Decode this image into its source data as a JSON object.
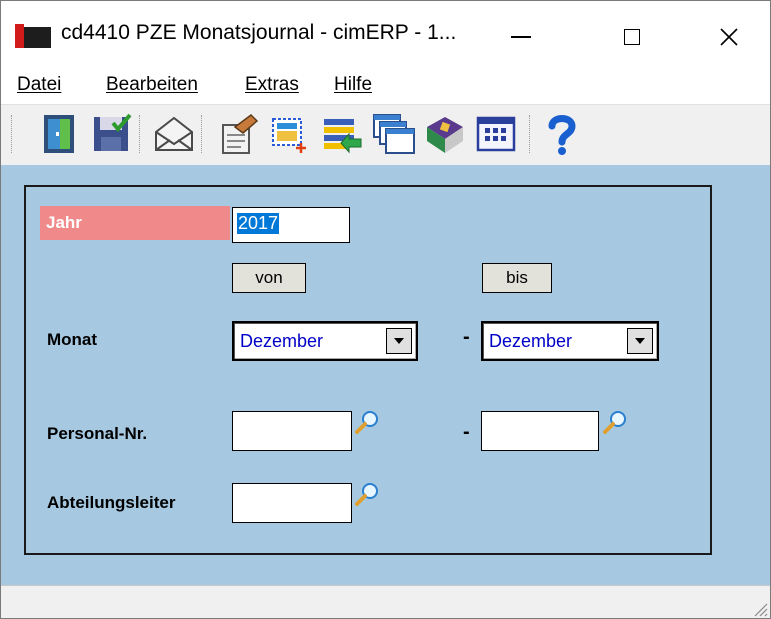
{
  "window": {
    "title": "cd4410 PZE Monatsjournal - cimERP - 1..."
  },
  "menu": [
    {
      "label": "Datei"
    },
    {
      "label": "Bearbeiten"
    },
    {
      "label": "Extras"
    },
    {
      "label": "Hilfe"
    }
  ],
  "toolbar": {
    "icons": [
      "exit-door-icon",
      "save-icon",
      "mail-icon",
      "edit-form-icon",
      "new-record-icon",
      "transfer-icon",
      "windows-icon",
      "book-icon",
      "calendar-grid-icon",
      "help-icon"
    ]
  },
  "form": {
    "jahr_label": "Jahr",
    "jahr_value": "2017",
    "von_label": "von",
    "bis_label": "bis",
    "monat_label": "Monat",
    "monat_von": "Dezember",
    "monat_bis": "Dezember",
    "dash": "-",
    "personal_label": "Personal-Nr.",
    "personal_von": "",
    "personal_bis": "",
    "abteilung_label": "Abteilungsleiter",
    "abteilung_value": ""
  },
  "colors": {
    "form_bg": "#a6c8e0",
    "jahr_label_bg": "#f08a8a",
    "selection": "#0078d7",
    "combo_text": "#0000c8"
  }
}
